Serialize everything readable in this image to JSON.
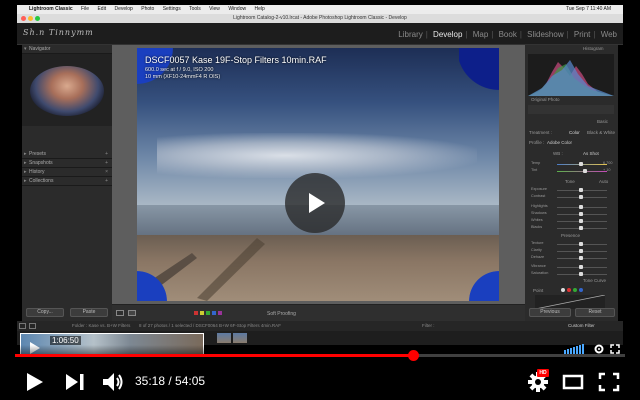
{
  "mac_menubar": {
    "app": "Lightroom Classic",
    "items": [
      "File",
      "Edit",
      "Develop",
      "Photo",
      "Settings",
      "Tools",
      "View",
      "Window",
      "Help"
    ],
    "status": "Tue Sep 7  11:40 AM"
  },
  "window": {
    "title": "Lightroom Catalog-2-v10.lrcat - Adobe Photoshop Lightroom Classic - Develop"
  },
  "signature": "Sh.n Tinnymm",
  "modules": [
    "Library",
    "Develop",
    "Map",
    "Book",
    "Slideshow",
    "Print",
    "Web"
  ],
  "active_module": "Develop",
  "left_panel": {
    "navigator": "Navigator",
    "sections": [
      "Presets",
      "Snapshots",
      "History",
      "Collections"
    ],
    "copy_label": "Copy...",
    "paste_label": "Paste"
  },
  "photo": {
    "title": "DSCF0057 Kase 19F-Stop Filters 10min.RAF",
    "exposure": "600.0 sec at f / 9.0, ISO 200",
    "lens": "10 mm (XF10-24mmF4 R OIS)"
  },
  "center_toolbar": {
    "soft_proofing": "Soft Proofing"
  },
  "right_panel": {
    "histogram_label": "Histogram",
    "original_photo": "Original Photo",
    "basic_label": "Basic",
    "treatment": "Treatment :",
    "color": "Color",
    "bw": "Black & White",
    "profile": "Profile :",
    "profile_value": "Adobe Color",
    "wb_label": "WB :",
    "wb_value": "As Shot",
    "temp_label": "Temp",
    "temp_value": "6,700",
    "tint_label": "Tint",
    "tint_value": "+ 10",
    "tone_label": "Tone",
    "auto_label": "Auto",
    "tone_sliders": [
      "Exposure",
      "Contrast",
      "Highlights",
      "Shadows",
      "Whites",
      "Blacks"
    ],
    "presence_label": "Presence",
    "presence_sliders": [
      "Texture",
      "Clarity",
      "Dehaze",
      "Vibrance",
      "Saturation"
    ],
    "tone_curve_label": "Tone Curve",
    "point_label": "Point",
    "previous_label": "Previous",
    "reset_label": "Reset"
  },
  "filmstrip": {
    "folder_text": "Folder : Kase vs. B+W Filters",
    "selection_text": "8 of 27 photos / 1 selected / DSCF0064 B+W 6F-Stop Filters 4min.RAF",
    "filter_label": "Filter :",
    "custom_filter": "Custom Filter"
  },
  "player": {
    "current_time": "35:18",
    "duration": "54:05",
    "time_display": "35:18 / 54:05",
    "hover_time": "1:06:50",
    "hd_badge": "HD",
    "progress": 0.653
  },
  "colors": {
    "accent_red": "#ff0000",
    "photo_blue_border": "#1a3fbf"
  },
  "icons": [
    "play-icon",
    "next-icon",
    "volume-icon",
    "settings-icon",
    "theater-mode-icon",
    "fullscreen-icon"
  ]
}
